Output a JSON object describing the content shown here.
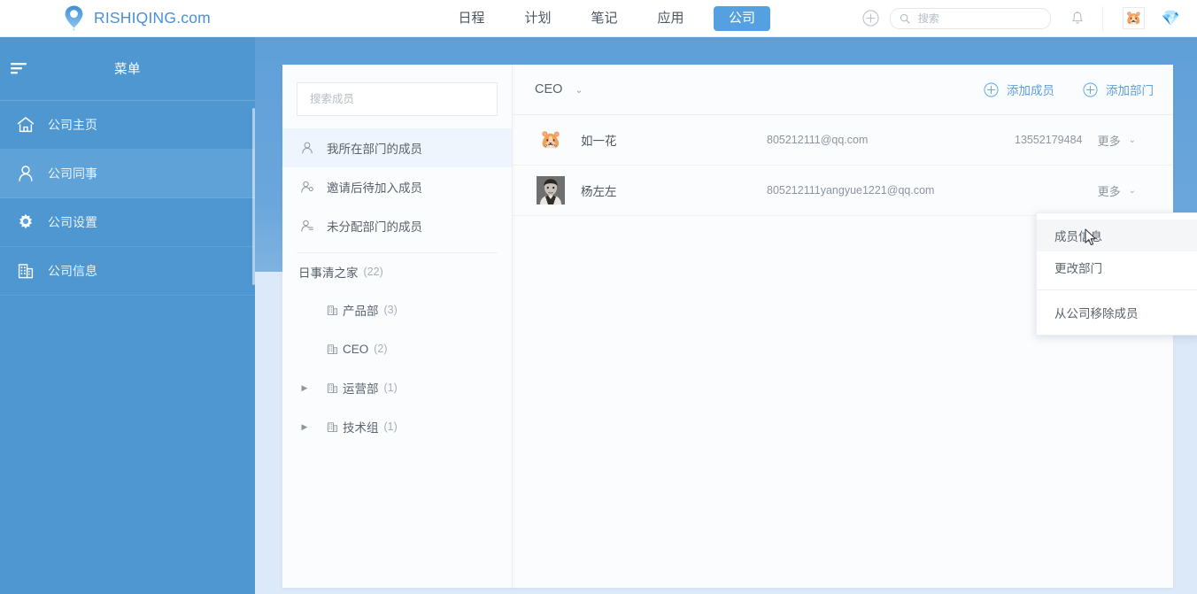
{
  "brand": {
    "name": "RISHIQING.com",
    "logo_icon": "location-pin-icon",
    "accent": "#4a90d9"
  },
  "topnav": {
    "items": [
      {
        "label": "日程",
        "active": false
      },
      {
        "label": "计划",
        "active": false
      },
      {
        "label": "笔记",
        "active": false
      },
      {
        "label": "应用",
        "active": false
      },
      {
        "label": "公司",
        "active": true
      }
    ],
    "active_color": "#54a0e0"
  },
  "topright": {
    "add_icon": "circle-plus-icon",
    "search": {
      "placeholder": "搜索",
      "value": "",
      "icon": "search-icon"
    },
    "notification_icon": "bell-icon",
    "avatar_icon": "pikachu-avatar-icon",
    "gem_icon": "diamond-icon"
  },
  "sidebar": {
    "title": "菜单",
    "burger_icon": "hamburger-menu-icon",
    "bg": "#4e97d1",
    "items": [
      {
        "label": "公司主页",
        "icon": "home-icon",
        "selected": false
      },
      {
        "label": "公司同事",
        "icon": "person-icon",
        "selected": true
      },
      {
        "label": "公司设置",
        "icon": "gear-icon",
        "selected": false
      },
      {
        "label": "公司信息",
        "icon": "building-icon",
        "selected": false
      }
    ]
  },
  "midpanel": {
    "search": {
      "placeholder": "搜索成员",
      "value": ""
    },
    "filters": [
      {
        "label": "我所在部门的成员",
        "icon": "person-icon",
        "selected": true
      },
      {
        "label": "邀请后待加入成员",
        "icon": "person-pending-icon",
        "selected": false
      },
      {
        "label": "未分配部门的成员",
        "icon": "person-unassigned-icon",
        "selected": false
      }
    ],
    "group": {
      "label": "日事清之家",
      "count": "(22)"
    },
    "departments": [
      {
        "label": "产品部",
        "count": "(3)",
        "expandable": false,
        "icon": "building-icon"
      },
      {
        "label": "CEO",
        "count": "(2)",
        "expandable": false,
        "icon": "building-icon"
      },
      {
        "label": "运营部",
        "count": "(1)",
        "expandable": true,
        "icon": "building-icon"
      },
      {
        "label": "技术组",
        "count": "(1)",
        "expandable": true,
        "icon": "building-icon"
      }
    ]
  },
  "mainpanel": {
    "title": "CEO",
    "title_caret": "chevron-down-icon",
    "actions": [
      {
        "label": "添加成员",
        "icon": "circle-plus-icon"
      },
      {
        "label": "添加部门",
        "icon": "circle-plus-icon"
      }
    ],
    "more_label": "更多",
    "members": [
      {
        "name": "如一花",
        "email": "805212111@qq.com",
        "phone": "13552179484",
        "avatar_icon": "pikachu-avatar-icon",
        "avatar_type": "emoji"
      },
      {
        "name": "杨左左",
        "email": "805212111yangyue1221@qq.com",
        "phone": "",
        "avatar_icon": "photo-avatar-icon",
        "avatar_type": "photo"
      }
    ]
  },
  "dropdown": {
    "items": [
      {
        "label": "成员信息",
        "hover": true
      },
      {
        "label": "更改部门",
        "hover": false
      },
      {
        "label": "从公司移除成员",
        "hover": false
      }
    ]
  }
}
